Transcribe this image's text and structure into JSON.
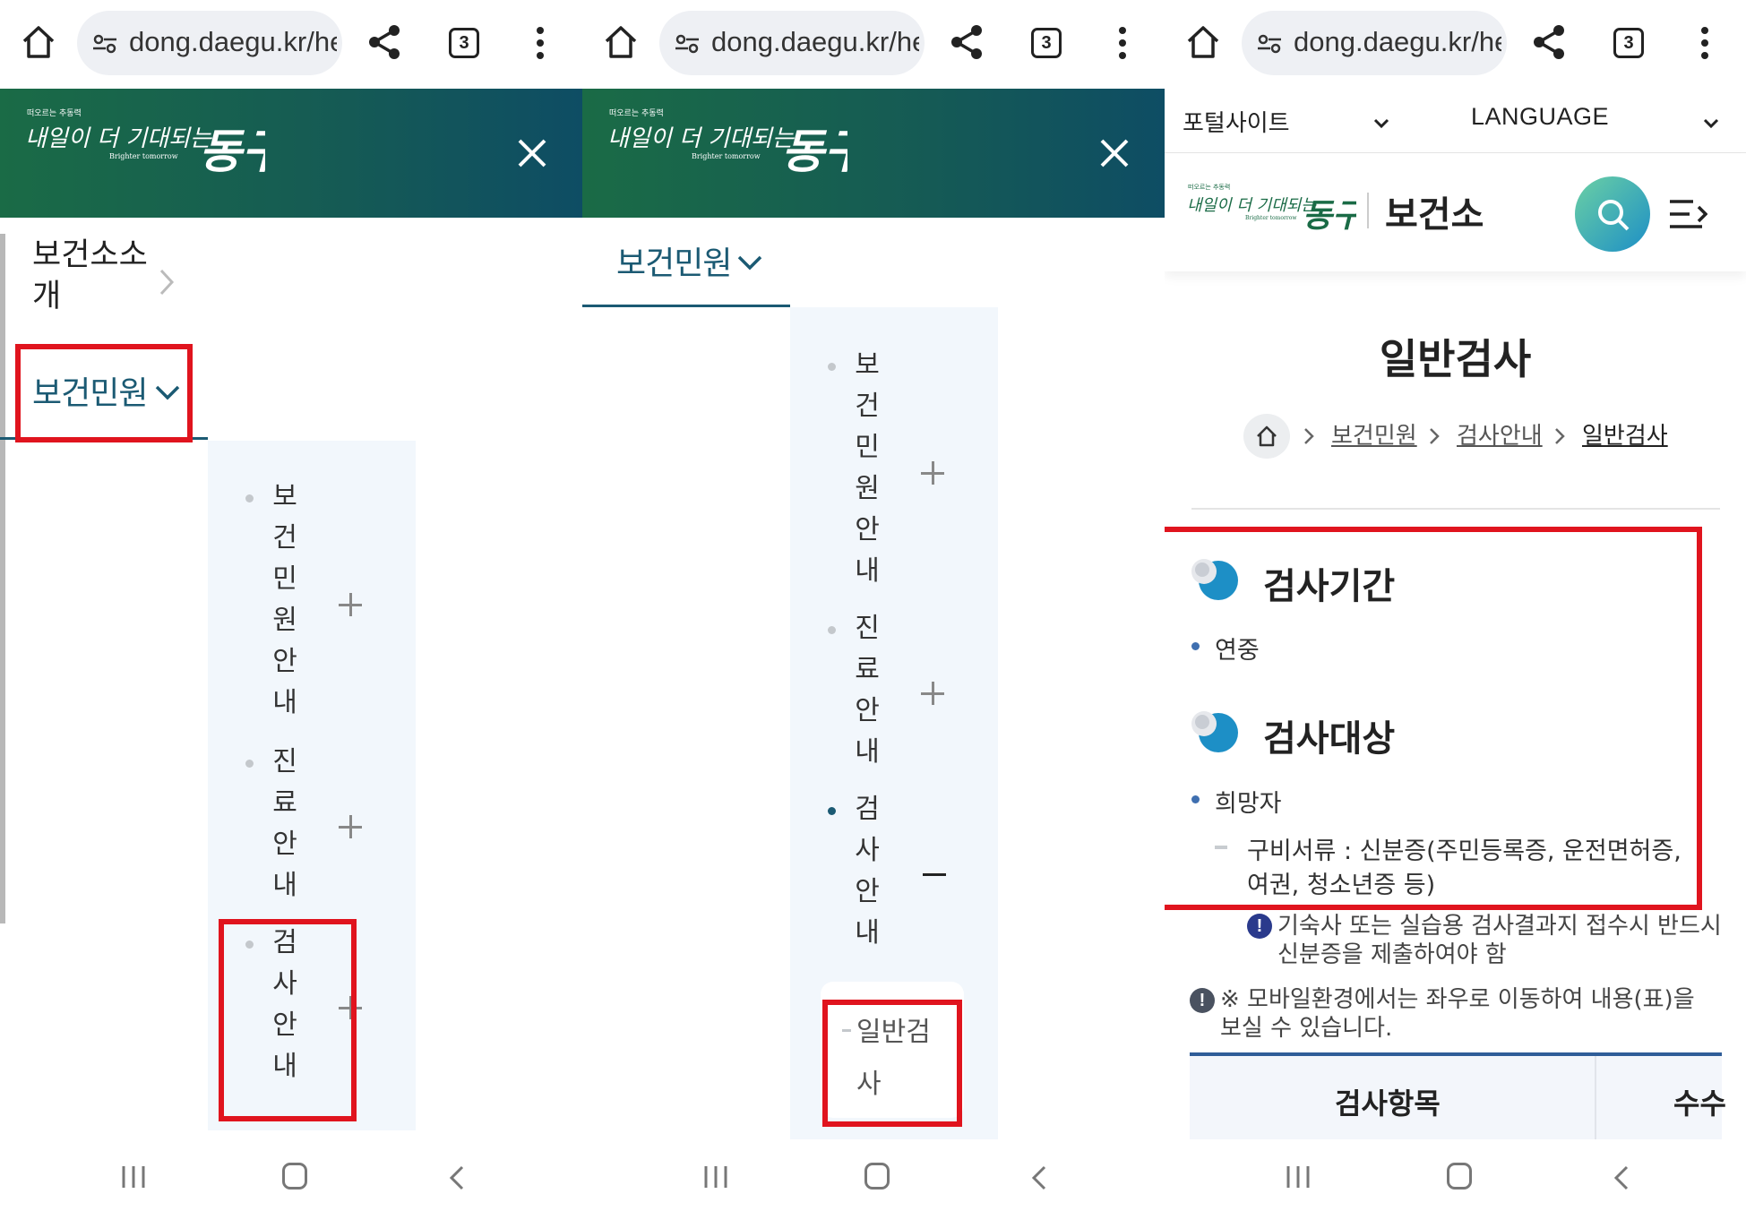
{
  "browser": {
    "url": "dong.daegu.kr/he",
    "tab_count": "3",
    "icons": [
      "home-icon",
      "site-settings-icon",
      "share-icon",
      "tabs-icon",
      "more-icon"
    ]
  },
  "header": {
    "logo_alt": "내일이 더 기대되는 동구 Brighter tomorrow",
    "close_icon": "close-icon",
    "background": "#17614f"
  },
  "screen1": {
    "menu": [
      {
        "label": "보건소소개",
        "expanded": false
      },
      {
        "label": "보건민원",
        "expanded": true
      }
    ],
    "submenu": [
      {
        "label": "보건민원안내",
        "toggle": "+"
      },
      {
        "label": "진료안내",
        "toggle": "+"
      },
      {
        "label": "검사안내",
        "toggle": "+"
      }
    ]
  },
  "screen2": {
    "menu_active": "보건민원",
    "submenu": [
      {
        "label": "보건민원안내",
        "toggle": "+"
      },
      {
        "label": "진료안내",
        "toggle": "+"
      },
      {
        "label": "검사안내",
        "toggle": "−"
      }
    ],
    "leaf": "일반검사"
  },
  "screen3": {
    "portal_label": "포털사이트",
    "language_label": "LANGUAGE",
    "org_name": "보건소",
    "page_title": "일반검사",
    "breadcrumb": [
      "보건민원",
      "검사안내",
      "일반검사"
    ],
    "sections": [
      {
        "title": "검사기간",
        "bullets": [
          "연중"
        ]
      },
      {
        "title": "검사대상",
        "bullets": [
          "희망자"
        ],
        "detail_line1": "구비서류 : 신분증(주민등록증, 운전면허증,",
        "detail_line2": "여권, 청소년증 등)"
      }
    ],
    "notice1_line1": "기숙사 또는 실습용 검사결과지 접수시 반드시",
    "notice1_line2": "신분증을 제출하여야 함",
    "notice2_line1": "※ 모바일환경에서는 좌우로 이동하여 내용(표)을",
    "notice2_line2": "보실 수 있습니다.",
    "table_headers": [
      "검사항목",
      "수수"
    ]
  },
  "colors": {
    "accent": "#1b5a73",
    "highlight": "#e0141e",
    "submenu_bg": "#f2f7fc",
    "table_border": "#2f5d98"
  },
  "nav": {
    "icons": [
      "recent-apps-icon",
      "home-button-icon",
      "back-icon"
    ]
  }
}
